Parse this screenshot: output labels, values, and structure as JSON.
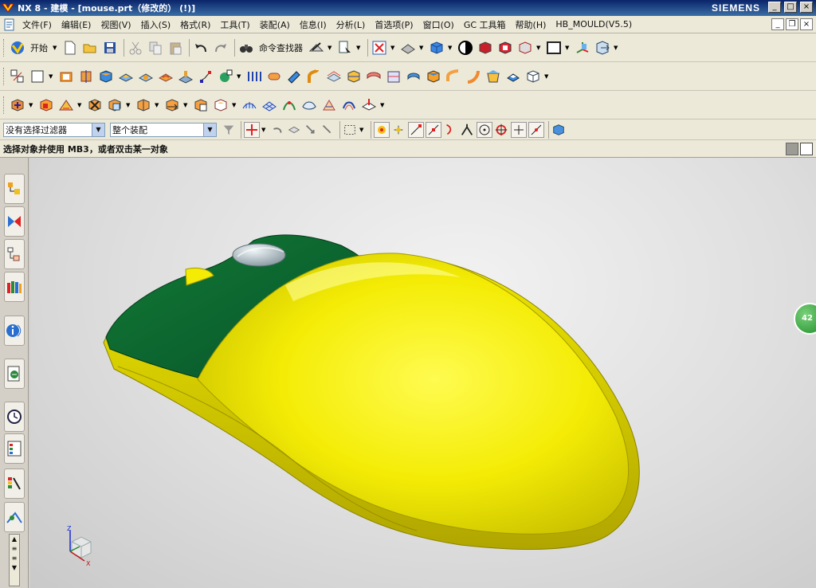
{
  "window": {
    "title": "NX 8 - 建模 - [mouse.prt（修改的） (!)]",
    "brand": "SIEMENS",
    "controls": [
      "_",
      "□",
      "×"
    ]
  },
  "menu": {
    "items": [
      "文件(F)",
      "编辑(E)",
      "视图(V)",
      "插入(S)",
      "格式(R)",
      "工具(T)",
      "装配(A)",
      "信息(I)",
      "分析(L)",
      "首选项(P)",
      "窗口(O)",
      "GC 工具箱",
      "帮助(H)",
      "HB_MOULD(V5.5)"
    ]
  },
  "toolbar": {
    "start_label": "开始",
    "command_finder_label": "命令查找器"
  },
  "selection_bar": {
    "filter_value": "没有选择过滤器",
    "scope_value": "整个装配"
  },
  "cue_line": "选择对象并使用 MB3，或者双击某一对象",
  "viewport": {
    "badge_text": "42",
    "triad": {
      "z": "Z",
      "x": "X"
    }
  },
  "colors": {
    "model_body": "#f0ea00",
    "model_shell": "#0a6b2a",
    "wheel": "#c9d3d8",
    "title_gradient": [
      "#0a246a",
      "#3a6ea5"
    ],
    "chrome": "#ece9d8"
  }
}
